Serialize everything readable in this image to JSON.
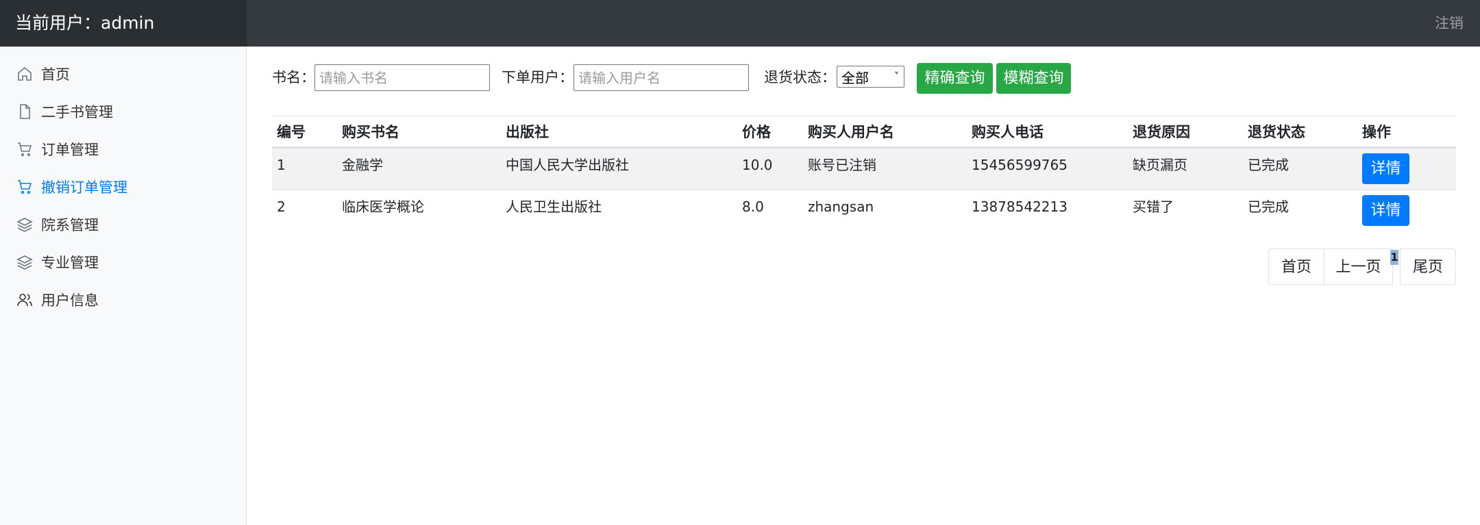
{
  "header": {
    "current_user": "当前用户：admin",
    "logout": "注销"
  },
  "sidebar": {
    "items": [
      {
        "label": "首页",
        "icon": "home-icon",
        "active": false
      },
      {
        "label": "二手书管理",
        "icon": "file-icon",
        "active": false
      },
      {
        "label": "订单管理",
        "icon": "cart-icon",
        "active": false
      },
      {
        "label": "撤销订单管理",
        "icon": "cart-icon",
        "active": true
      },
      {
        "label": "院系管理",
        "icon": "layers-icon",
        "active": false
      },
      {
        "label": "专业管理",
        "icon": "layers-icon",
        "active": false
      },
      {
        "label": "用户信息",
        "icon": "users-icon",
        "active": false
      }
    ]
  },
  "filter": {
    "book_label": "书名：",
    "book_placeholder": "请输入书名",
    "user_label": "下单用户：",
    "user_placeholder": "请输入用户名",
    "status_label": "退货状态：",
    "status_selected": "全部",
    "exact_button": "精确查询",
    "fuzzy_button": "模糊查询"
  },
  "table": {
    "headers": [
      "编号",
      "购买书名",
      "出版社",
      "价格",
      "购买人用户名",
      "购买人电话",
      "退货原因",
      "退货状态",
      "操作"
    ],
    "rows": [
      [
        "1",
        "金融学",
        "中国人民大学出版社",
        "10.0",
        "账号已注销",
        "15456599765",
        "缺页漏页",
        "已完成"
      ],
      [
        "2",
        "临床医学概论",
        "人民卫生出版社",
        "8.0",
        "zhangsan",
        "13878542213",
        "买错了",
        "已完成"
      ]
    ],
    "detail_button": "详情"
  },
  "pagination": {
    "first": "首页",
    "prev": "上一页",
    "current": "1",
    "last": "尾页"
  },
  "colors": {
    "navbar": "#343a40",
    "sidebar_active": "#007bff",
    "green_button": "#28a745",
    "primary_button": "#007bff"
  }
}
